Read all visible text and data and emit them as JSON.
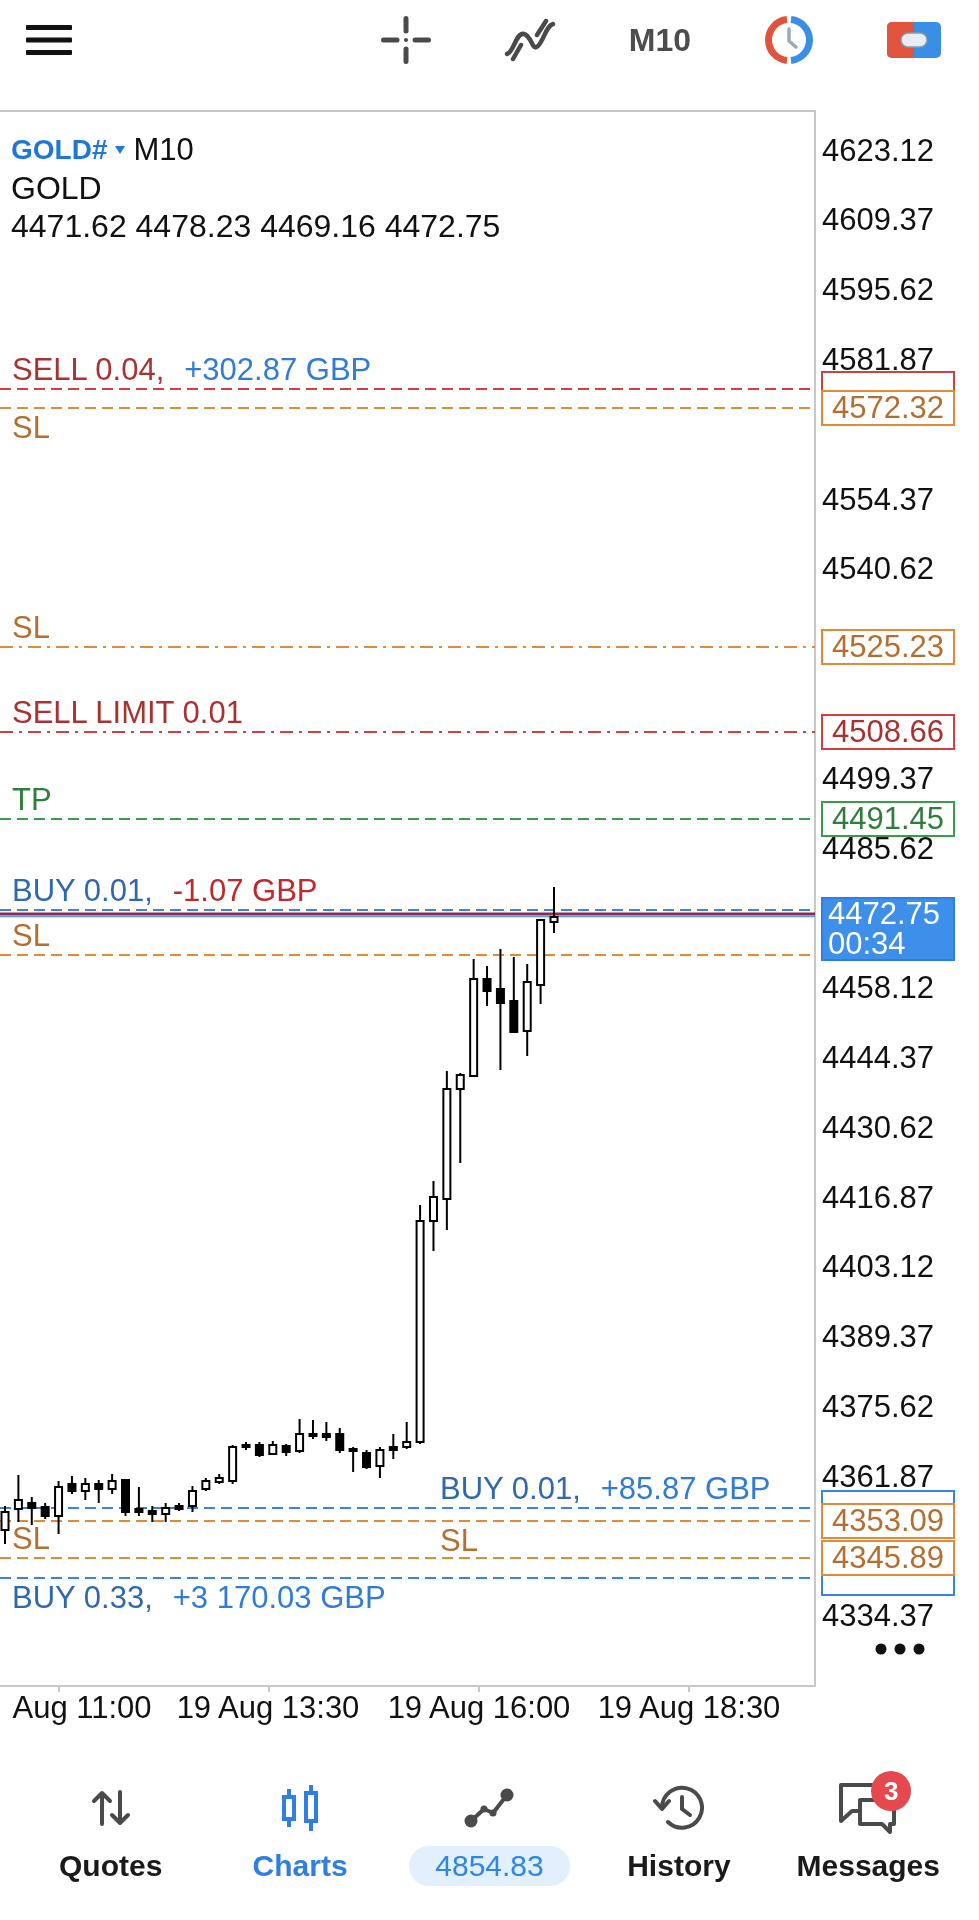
{
  "toolbar": {
    "timeframe": "M10"
  },
  "chart": {
    "symbol": "GOLD#",
    "timeframe": "M10",
    "description": "GOLD",
    "ohlc": "4471.62 4478.23 4469.16 4472.75",
    "price_axis": [
      "4623.12",
      "4609.37",
      "4595.62",
      "4581.87",
      "4554.37",
      "4540.62",
      "4499.37",
      "4485.62",
      "4458.12",
      "4444.37",
      "4430.62",
      "4416.87",
      "4403.12",
      "4389.37",
      "4375.62",
      "4361.87",
      "4334.37"
    ],
    "lines": [
      {
        "kind": "entry",
        "color": "#d23f3f",
        "label": "SELL 0.04,",
        "profit": {
          "text": "+302.87 GBP",
          "color": "#2f7bd6"
        }
      },
      {
        "kind": "stop",
        "color": "#e08a3c",
        "label": "SL",
        "price": "4572.32"
      },
      {
        "kind": "orderstop",
        "color": "#e08a3c",
        "label": "SL",
        "price": "4525.23"
      },
      {
        "kind": "order",
        "color": "#d23f3f",
        "label": "SELL LIMIT 0.01",
        "price": "4508.66"
      },
      {
        "kind": "target",
        "color": "#3a9c4a",
        "label": "TP",
        "price": "4491.45"
      },
      {
        "kind": "entry",
        "color": "#3b82d9",
        "label": "BUY 0.01,",
        "profit": {
          "text": "-1.07 GBP",
          "color": "#c0282d"
        }
      },
      {
        "kind": "stop",
        "color": "#e08a3c",
        "label": "SL"
      },
      {
        "kind": "entry",
        "color": "#3b82d9",
        "label": "BUY 0.01,",
        "profit": {
          "text": "+85.87 GBP",
          "color": "#2f7bd6"
        }
      },
      {
        "kind": "stop",
        "color": "#e08a3c",
        "label": "SL",
        "price": "4353.09"
      },
      {
        "kind": "stop",
        "color": "#e08a3c",
        "label": "SL",
        "price": "4345.89"
      },
      {
        "kind": "entry",
        "color": "#3b82d9",
        "label": "BUY 0.33,",
        "profit": {
          "text": "+3 170.03 GBP",
          "color": "#2f7bd6"
        }
      }
    ],
    "current_price": {
      "price": "4472.75",
      "countdown": "00:34"
    },
    "time_axis": [
      "Aug 11:00",
      "19 Aug 13:30",
      "19 Aug 16:00",
      "19 Aug 18:30"
    ]
  },
  "nav": [
    {
      "kind": "quotes",
      "label": "Quotes",
      "selected": false
    },
    {
      "kind": "charts",
      "label": "Charts",
      "selected": true
    },
    {
      "kind": "trade",
      "label": "4854.83",
      "selected": false
    },
    {
      "kind": "history",
      "label": "History",
      "selected": false
    },
    {
      "kind": "messages",
      "label": "Messages",
      "selected": false,
      "badge": "3"
    }
  ]
}
